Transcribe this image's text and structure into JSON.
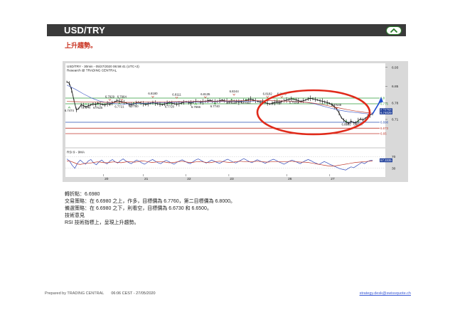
{
  "header": {
    "title": "USD/TRY",
    "toggle_icon": "chevron-up-icon"
  },
  "subtitle": "上升趨勢。",
  "chart_data": {
    "type": "line",
    "title": "USD/TRY - 30min - 05/27/2020 06:59:41 (UTC+2)",
    "subtitle": "Research @ TRADING CENTRAL",
    "x_ticks": [
      "20",
      "21",
      "22",
      "23",
      "26",
      "27"
    ],
    "y_ticks": [
      6.93,
      6.85,
      6.78,
      6.71
    ],
    "ylim": [
      6.62,
      6.95
    ],
    "series": [
      {
        "name": "price",
        "color": "#111111",
        "values": [
          6.869,
          6.863,
          6.835,
          6.79,
          6.75,
          6.756,
          6.772,
          6.768,
          6.762,
          6.768,
          6.771,
          6.775,
          6.772,
          6.779,
          6.775,
          6.773,
          6.771,
          6.776,
          6.773,
          6.779,
          6.784,
          6.789,
          6.787,
          6.785,
          6.782,
          6.779,
          6.774,
          6.772,
          6.775,
          6.779,
          6.783,
          6.779,
          6.776,
          6.773,
          6.775,
          6.778,
          6.781,
          6.779,
          6.776,
          6.774,
          6.772,
          6.775,
          6.778,
          6.781,
          6.779,
          6.776,
          6.774,
          6.776,
          6.779,
          6.782,
          6.784,
          6.781,
          6.779,
          6.783,
          6.787,
          6.785,
          6.782,
          6.784,
          6.786,
          6.789,
          6.791,
          6.787,
          6.784,
          6.786,
          6.789,
          6.792,
          6.789,
          6.787,
          6.784,
          6.786,
          6.789,
          6.786,
          6.783,
          6.785,
          6.788,
          6.791,
          6.793,
          6.796,
          6.792,
          6.789,
          6.786,
          6.783,
          6.785,
          6.781,
          6.778,
          6.775,
          6.778,
          6.781,
          6.784,
          6.782,
          6.786,
          6.789,
          6.792,
          6.794,
          6.797,
          6.796,
          6.793,
          6.789,
          6.786,
          6.789,
          6.792,
          6.796,
          6.799,
          6.797,
          6.794,
          6.792,
          6.789,
          6.787,
          6.784,
          6.781,
          6.778,
          6.772,
          6.764,
          6.754,
          6.737,
          6.717,
          6.707,
          6.699,
          6.694,
          6.702,
          6.697,
          6.695,
          6.705,
          6.712,
          6.707,
          6.715,
          6.723,
          6.729,
          6.733
        ]
      },
      {
        "name": "moving-average",
        "color": "#4a63c8",
        "values": [
          6.855,
          6.838,
          6.818,
          6.8,
          6.787,
          6.78,
          6.776,
          6.775,
          6.776,
          6.778,
          6.779,
          6.78,
          6.781,
          6.782,
          6.783,
          6.783,
          6.784,
          6.785,
          6.785,
          6.786,
          6.786,
          6.787,
          6.787,
          6.788,
          6.789,
          6.789,
          6.788,
          6.787,
          6.785,
          6.782,
          6.776,
          6.766,
          6.757,
          6.749,
          6.743,
          6.739,
          6.735,
          6.732
        ]
      },
      {
        "name": "moving-average-2",
        "color": "#c0392b",
        "values": [
          6.786,
          6.785,
          6.784,
          6.783,
          6.783,
          6.782,
          6.782,
          6.782,
          6.782,
          6.783,
          6.783,
          6.784,
          6.784,
          6.785,
          6.785,
          6.786,
          6.786,
          6.787,
          6.787,
          6.788,
          6.788,
          6.789,
          6.789,
          6.789,
          6.789,
          6.789,
          6.788,
          6.787,
          6.785,
          6.782,
          6.778,
          6.772,
          6.765,
          6.758,
          6.751,
          6.745,
          6.74,
          6.736
        ]
      }
    ],
    "right_labels": [
      {
        "text": "6.93"
      },
      {
        "text": "6.85"
      },
      {
        "text": "6.78"
      },
      {
        "text": "6.74798"
      },
      {
        "text": "6.74029"
      },
      {
        "text": "6.71"
      },
      {
        "text": "6.698"
      },
      {
        "text": "6.673"
      },
      {
        "text": "6.65"
      },
      {
        "text": "6.8"
      },
      {
        "text": "6.776"
      }
    ],
    "levels": [
      {
        "value": 6.8,
        "label": "6.8",
        "color": "#2f9e3a"
      },
      {
        "value": 6.776,
        "label": "6.776",
        "color": "#2f9e3a"
      },
      {
        "value": 6.698,
        "label": "6.698",
        "color": "#2a4fb0"
      },
      {
        "value": 6.673,
        "label": "6.673",
        "color": "#c0392b"
      },
      {
        "value": 6.65,
        "label": "6.65",
        "color": "#c0392b"
      }
    ],
    "current_prices": [
      6.74798,
      6.74029
    ],
    "price_annotations": [
      {
        "text": "6.7474",
        "v": 6.747,
        "i": 1
      },
      {
        "text": "6.7929",
        "v": 6.806,
        "i": 18
      },
      {
        "text": "6.7964",
        "v": 6.806,
        "i": 23
      },
      {
        "text": "6.8180",
        "v": 6.819,
        "i": 36
      },
      {
        "text": "6.8111",
        "v": 6.815,
        "i": 46
      },
      {
        "text": "6.8135",
        "v": 6.817,
        "i": 58
      },
      {
        "text": "6.8244",
        "v": 6.828,
        "i": 70
      },
      {
        "text": "6.8182",
        "v": 6.818,
        "i": 84
      },
      {
        "text": "6.8170",
        "v": 6.818,
        "i": 90
      },
      {
        "text": "6.7646",
        "v": 6.761,
        "i": 8
      },
      {
        "text": "6.7625",
        "v": 6.759,
        "i": 13
      },
      {
        "text": "6.7721",
        "v": 6.764,
        "i": 22
      },
      {
        "text": "6.7750",
        "v": 6.766,
        "i": 28
      },
      {
        "text": "6.7720",
        "v": 6.764,
        "i": 43
      },
      {
        "text": "6.7666",
        "v": 6.762,
        "i": 54
      },
      {
        "text": "6.7740",
        "v": 6.765,
        "i": 62
      },
      {
        "text": "6.7648",
        "v": 6.78,
        "i": 69
      },
      {
        "text": "6.7663",
        "v": 6.78,
        "i": 75
      },
      {
        "text": "6.7650",
        "v": 6.779,
        "i": 88
      },
      {
        "text": "6.7633",
        "v": 6.782,
        "i": 95
      },
      {
        "text": "6.7648",
        "v": 6.771,
        "i": 113
      },
      {
        "text": "6.6905",
        "v": 6.689,
        "i": 117
      },
      {
        "text": "6.6957",
        "v": 6.689,
        "i": 122
      }
    ],
    "rsi": {
      "label": "RSI 9 - 9MA",
      "y_ticks": [
        70,
        30
      ],
      "current_value": "57.3335",
      "ylim": [
        10,
        90
      ],
      "rsi_values": [
        62,
        55,
        40,
        30,
        48,
        58,
        50,
        44,
        55,
        60,
        48,
        42,
        52,
        58,
        50,
        45,
        54,
        60,
        52,
        48,
        56,
        62,
        55,
        50,
        46,
        52,
        58,
        54,
        48,
        44,
        50,
        56,
        60,
        54,
        49,
        46,
        52,
        57,
        53,
        48,
        44,
        50,
        55,
        59,
        54,
        49,
        46,
        52,
        58,
        62,
        57,
        52,
        48,
        53,
        58,
        54,
        50,
        47,
        52,
        57,
        61,
        56,
        51,
        48,
        53,
        58,
        63,
        58,
        53,
        49,
        54,
        59,
        55,
        51,
        47,
        52,
        57,
        61,
        57,
        52,
        48,
        44,
        49,
        54,
        58,
        54,
        50,
        46,
        51,
        56,
        60,
        56,
        51,
        47,
        43,
        48,
        53,
        49,
        44,
        40,
        36,
        32,
        28,
        26,
        24,
        30,
        35,
        32,
        38,
        44,
        50,
        46,
        52,
        56,
        57
      ],
      "ma_values": [
        55,
        54,
        50,
        45,
        43,
        46,
        48,
        48,
        50,
        52,
        51,
        49,
        49,
        51,
        52,
        50,
        49,
        51,
        53,
        52,
        51,
        53,
        55,
        54,
        52,
        50,
        51,
        53,
        53,
        51,
        49,
        49,
        51,
        53,
        54,
        52,
        50,
        50,
        52,
        53,
        52,
        50,
        49,
        51,
        53,
        54,
        53,
        51,
        50,
        51,
        53,
        54,
        53,
        52,
        52,
        53,
        54,
        53,
        52,
        51,
        52,
        53,
        53,
        52,
        52,
        53,
        54,
        53,
        52,
        51,
        51,
        50,
        48,
        46,
        44,
        42,
        40,
        38,
        37,
        38,
        40,
        42,
        44,
        46,
        48,
        50,
        51,
        52,
        53,
        54,
        55
      ]
    }
  },
  "analysis": {
    "pivot": "轉折點：6.6980",
    "strategy": "交易策略：在 6.6980 之上，作多，目標價為 6.7760，第二目標價為 6.8000。",
    "alternative": "備選策略：在 6.6980 之下，則看空，目標價為 6.6730 和 6.6500。",
    "comment_title": "技術意見",
    "comment": "RSI 技術指標上，呈現上升趨勢。"
  },
  "footer": {
    "prepared": "Prepared by TRADING CENTRAL",
    "time": "06:06 CEST - 27/05/2020",
    "email": "strategy.desk@swissquote.ch"
  },
  "colors": {
    "header_bg": "#3a3a3a",
    "subtitle": "#c8301e",
    "ellipse": "#e02a1a",
    "arrow": "#1f4fd1",
    "current_price_box": "#1f3f9a"
  }
}
